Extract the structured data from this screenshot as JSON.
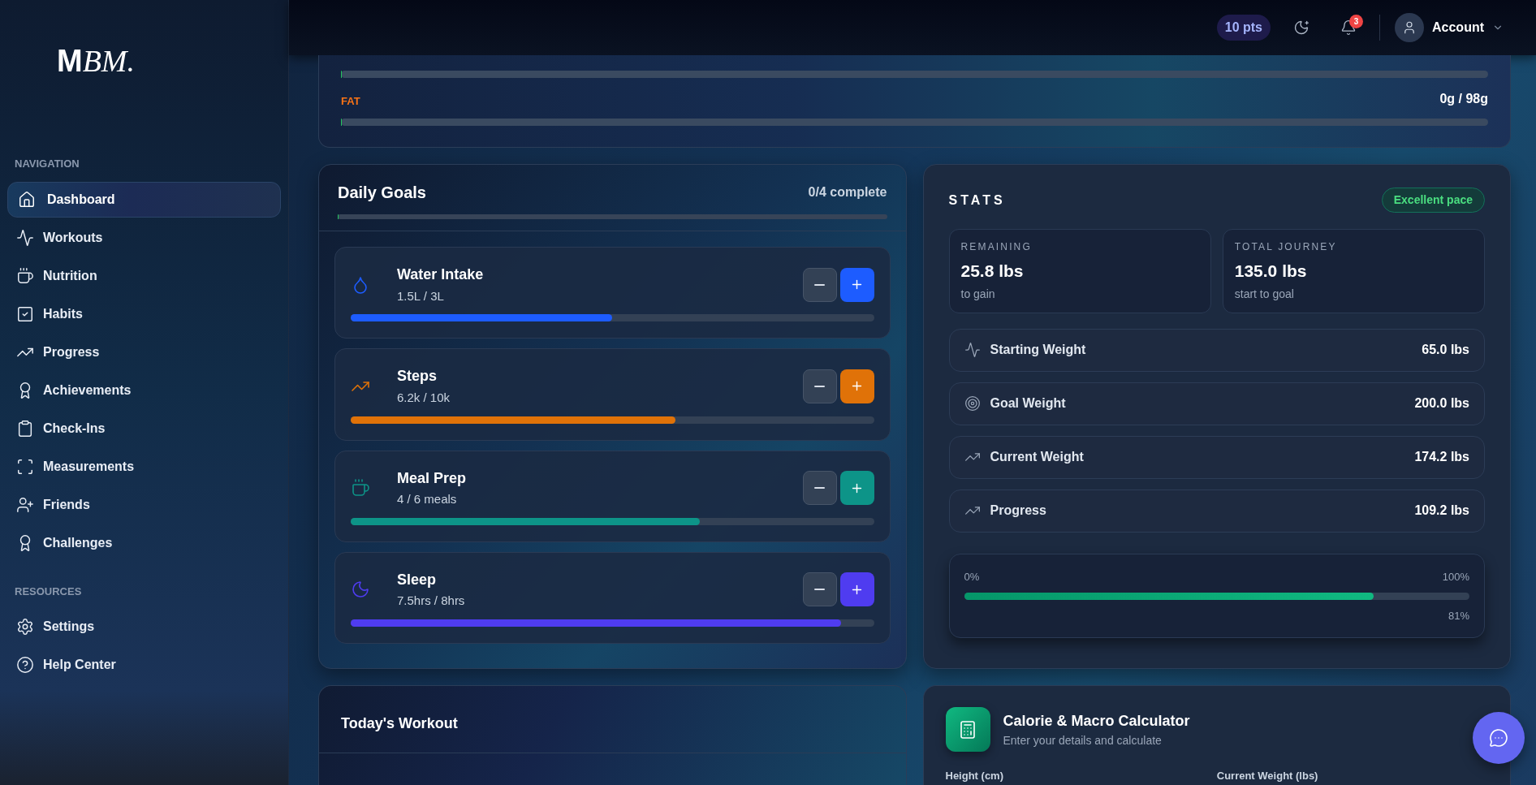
{
  "logo": {
    "bold": "M",
    "italic": "BM."
  },
  "sidebar": {
    "sections": [
      {
        "title": "NAVIGATION",
        "items": [
          {
            "label": "Dashboard",
            "selected": true
          },
          {
            "label": "Workouts",
            "selected": false
          },
          {
            "label": "Nutrition",
            "selected": false
          },
          {
            "label": "Habits",
            "selected": false
          },
          {
            "label": "Progress",
            "selected": false
          },
          {
            "label": "Achievements",
            "selected": false
          },
          {
            "label": "Check-Ins",
            "selected": false
          },
          {
            "label": "Measurements",
            "selected": false
          },
          {
            "label": "Friends",
            "selected": false
          },
          {
            "label": "Challenges",
            "selected": false
          }
        ]
      },
      {
        "title": "RESOURCES",
        "items": [
          {
            "label": "Settings",
            "selected": false
          },
          {
            "label": "Help Center",
            "selected": false
          }
        ]
      }
    ]
  },
  "header": {
    "points": "10 pts",
    "notifications": "3",
    "account": "Account"
  },
  "macros": [
    {
      "level": 0
    },
    {
      "label": "FAT",
      "value": "0g / 98g",
      "level": 0
    }
  ],
  "daily_goals": {
    "title": "Daily Goals",
    "summary": "0/4 complete",
    "level": 0,
    "goals": [
      {
        "name": "Water Intake",
        "reading": "1.5L / 3L",
        "level": 0.5,
        "color": "#1d5cff"
      },
      {
        "name": "Steps",
        "reading": "6.2k / 10k",
        "level": 0.62,
        "color": "#e07208"
      },
      {
        "name": "Meal Prep",
        "reading": "4 / 6 meals",
        "level": 0.667,
        "color": "#0d9488"
      },
      {
        "name": "Sleep",
        "reading": "7.5hrs / 8hrs",
        "level": 0.937,
        "color": "#4f3cf0"
      }
    ]
  },
  "stats": {
    "title": "STATS",
    "badge": "Excellent pace",
    "tiles": [
      {
        "label": "REMAINING",
        "value": "25.8 lbs",
        "note": "to gain"
      },
      {
        "label": "TOTAL JOURNEY",
        "value": "135.0 lbs",
        "note": "start to goal"
      }
    ],
    "rows": [
      {
        "label": "Starting Weight",
        "value": "65.0 lbs"
      },
      {
        "label": "Goal Weight",
        "value": "200.0 lbs"
      },
      {
        "label": "Current Weight",
        "value": "174.2 lbs"
      },
      {
        "label": "Progress",
        "value": "109.2 lbs"
      }
    ],
    "progress": {
      "min": "0%",
      "max": "100%",
      "level": 0.81,
      "reading": "81%"
    }
  },
  "workout": {
    "title": "Today's Workout"
  },
  "calculator": {
    "title": "Calorie & Macro Calculator",
    "subtitle": "Enter your details and calculate",
    "fields": [
      "Height (cm)",
      "Current Weight (lbs)"
    ]
  }
}
